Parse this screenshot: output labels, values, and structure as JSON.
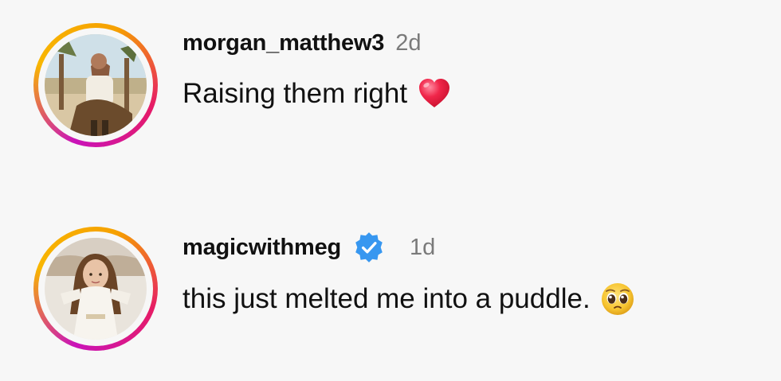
{
  "comments": [
    {
      "username": "morgan_matthew3",
      "time": "2d",
      "verified": false,
      "text": "Raising them right",
      "emoji": "red-heart-icon"
    },
    {
      "username": "magicwithmeg",
      "time": "1d",
      "verified": true,
      "text": "this just melted me into a puddle.",
      "emoji": "pleading-face-icon"
    }
  ],
  "colors": {
    "background": "#f7f7f7",
    "story_ring_start": "#c913b9",
    "story_ring_end": "#f8b600",
    "verified_blue": "#3797f0",
    "timestamp_gray": "#7a7a7a",
    "heart_red": "#f0264a"
  }
}
